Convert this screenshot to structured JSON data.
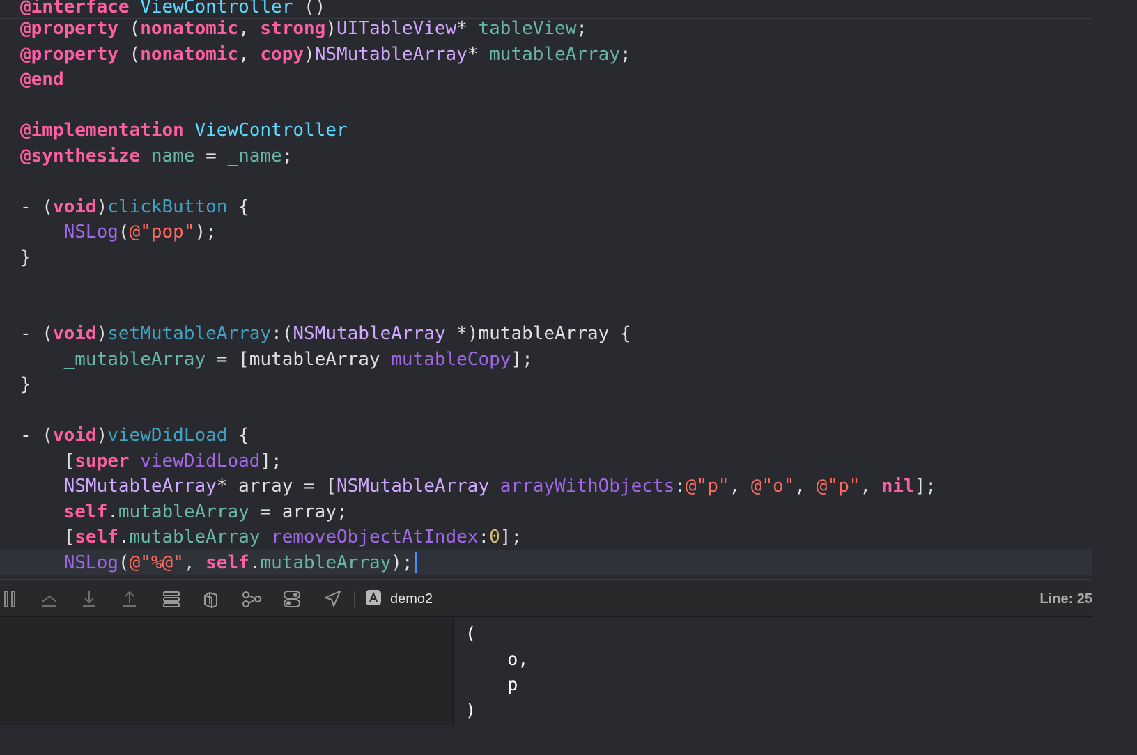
{
  "editor": {
    "lines": [
      {
        "kind": "sticky",
        "tokens": [
          {
            "t": "@interface",
            "c": "kw"
          },
          {
            "t": " ",
            "c": "pl"
          },
          {
            "t": "ViewController",
            "c": "cls"
          },
          {
            "t": " ()",
            "c": "pl"
          }
        ]
      },
      {
        "tokens": [
          {
            "t": "@property",
            "c": "kw"
          },
          {
            "t": " (",
            "c": "pl"
          },
          {
            "t": "nonatomic",
            "c": "kw"
          },
          {
            "t": ", ",
            "c": "pl"
          },
          {
            "t": "strong",
            "c": "kw"
          },
          {
            "t": ")",
            "c": "pl"
          },
          {
            "t": "UITableView",
            "c": "type"
          },
          {
            "t": "* ",
            "c": "pl"
          },
          {
            "t": "tableView",
            "c": "prop"
          },
          {
            "t": ";",
            "c": "pl"
          }
        ]
      },
      {
        "tokens": [
          {
            "t": "@property",
            "c": "kw"
          },
          {
            "t": " (",
            "c": "pl"
          },
          {
            "t": "nonatomic",
            "c": "kw"
          },
          {
            "t": ", ",
            "c": "pl"
          },
          {
            "t": "copy",
            "c": "kw"
          },
          {
            "t": ")",
            "c": "pl"
          },
          {
            "t": "NSMutableArray",
            "c": "type"
          },
          {
            "t": "* ",
            "c": "pl"
          },
          {
            "t": "mutableArray",
            "c": "prop"
          },
          {
            "t": ";",
            "c": "pl"
          }
        ]
      },
      {
        "tokens": [
          {
            "t": "@end",
            "c": "kw"
          }
        ]
      },
      {
        "tokens": []
      },
      {
        "tokens": [
          {
            "t": "@implementation",
            "c": "kw"
          },
          {
            "t": " ",
            "c": "pl"
          },
          {
            "t": "ViewController",
            "c": "cls"
          }
        ]
      },
      {
        "tokens": [
          {
            "t": "@synthesize",
            "c": "kw"
          },
          {
            "t": " ",
            "c": "pl"
          },
          {
            "t": "name",
            "c": "prop"
          },
          {
            "t": " = ",
            "c": "pl"
          },
          {
            "t": "_name",
            "c": "prop"
          },
          {
            "t": ";",
            "c": "pl"
          }
        ]
      },
      {
        "tokens": []
      },
      {
        "tokens": [
          {
            "t": "- (",
            "c": "pl"
          },
          {
            "t": "void",
            "c": "kw"
          },
          {
            "t": ")",
            "c": "pl"
          },
          {
            "t": "clickButton",
            "c": "fn"
          },
          {
            "t": " {",
            "c": "pl"
          }
        ]
      },
      {
        "tokens": [
          {
            "t": "    ",
            "c": "pl"
          },
          {
            "t": "NSLog",
            "c": "func"
          },
          {
            "t": "(",
            "c": "pl"
          },
          {
            "t": "@\"pop\"",
            "c": "str"
          },
          {
            "t": ");",
            "c": "pl"
          }
        ]
      },
      {
        "tokens": [
          {
            "t": "}",
            "c": "pl"
          }
        ]
      },
      {
        "tokens": []
      },
      {
        "tokens": []
      },
      {
        "tokens": [
          {
            "t": "- (",
            "c": "pl"
          },
          {
            "t": "void",
            "c": "kw"
          },
          {
            "t": ")",
            "c": "pl"
          },
          {
            "t": "setMutableArray",
            "c": "fn"
          },
          {
            "t": ":(",
            "c": "pl"
          },
          {
            "t": "NSMutableArray",
            "c": "type"
          },
          {
            "t": " *)mutableArray {",
            "c": "pl"
          }
        ]
      },
      {
        "tokens": [
          {
            "t": "    ",
            "c": "pl"
          },
          {
            "t": "_mutableArray",
            "c": "prop"
          },
          {
            "t": " = [mutableArray ",
            "c": "pl"
          },
          {
            "t": "mutableCopy",
            "c": "func"
          },
          {
            "t": "];",
            "c": "pl"
          }
        ]
      },
      {
        "tokens": [
          {
            "t": "}",
            "c": "pl"
          }
        ]
      },
      {
        "tokens": []
      },
      {
        "tokens": [
          {
            "t": "- (",
            "c": "pl"
          },
          {
            "t": "void",
            "c": "kw"
          },
          {
            "t": ")",
            "c": "pl"
          },
          {
            "t": "viewDidLoad",
            "c": "fn"
          },
          {
            "t": " {",
            "c": "pl"
          }
        ]
      },
      {
        "tokens": [
          {
            "t": "    [",
            "c": "pl"
          },
          {
            "t": "super",
            "c": "kw"
          },
          {
            "t": " ",
            "c": "pl"
          },
          {
            "t": "viewDidLoad",
            "c": "func"
          },
          {
            "t": "];",
            "c": "pl"
          }
        ]
      },
      {
        "tokens": [
          {
            "t": "    ",
            "c": "pl"
          },
          {
            "t": "NSMutableArray",
            "c": "type"
          },
          {
            "t": "* array = [",
            "c": "pl"
          },
          {
            "t": "NSMutableArray",
            "c": "type"
          },
          {
            "t": " ",
            "c": "pl"
          },
          {
            "t": "arrayWithObjects",
            "c": "func"
          },
          {
            "t": ":",
            "c": "pl"
          },
          {
            "t": "@\"p\"",
            "c": "str"
          },
          {
            "t": ", ",
            "c": "pl"
          },
          {
            "t": "@\"o\"",
            "c": "str"
          },
          {
            "t": ", ",
            "c": "pl"
          },
          {
            "t": "@\"p\"",
            "c": "str"
          },
          {
            "t": ", ",
            "c": "pl"
          },
          {
            "t": "nil",
            "c": "kw"
          },
          {
            "t": "];",
            "c": "pl"
          }
        ]
      },
      {
        "tokens": [
          {
            "t": "    ",
            "c": "pl"
          },
          {
            "t": "self",
            "c": "kw"
          },
          {
            "t": ".",
            "c": "pl"
          },
          {
            "t": "mutableArray",
            "c": "prop"
          },
          {
            "t": " = array;",
            "c": "pl"
          }
        ]
      },
      {
        "tokens": [
          {
            "t": "    [",
            "c": "pl"
          },
          {
            "t": "self",
            "c": "kw"
          },
          {
            "t": ".",
            "c": "pl"
          },
          {
            "t": "mutableArray",
            "c": "prop"
          },
          {
            "t": " ",
            "c": "pl"
          },
          {
            "t": "removeObjectAtIndex",
            "c": "func"
          },
          {
            "t": ":",
            "c": "pl"
          },
          {
            "t": "0",
            "c": "num"
          },
          {
            "t": "];",
            "c": "pl"
          }
        ]
      },
      {
        "kind": "current",
        "tokens": [
          {
            "t": "    ",
            "c": "pl"
          },
          {
            "t": "NSLog",
            "c": "func"
          },
          {
            "t": "(",
            "c": "pl"
          },
          {
            "t": "@\"%@\"",
            "c": "str"
          },
          {
            "t": ", ",
            "c": "pl"
          },
          {
            "t": "self",
            "c": "kw"
          },
          {
            "t": ".",
            "c": "pl"
          },
          {
            "t": "mutableArray",
            "c": "prop"
          },
          {
            "t": ");",
            "c": "pl"
          }
        ]
      }
    ]
  },
  "debug_bar": {
    "icons": [
      {
        "name": "hide-debug-area-icon",
        "interactable": true
      },
      {
        "name": "step-over-icon",
        "interactable": true
      },
      {
        "name": "step-into-icon",
        "interactable": true
      },
      {
        "name": "step-out-icon",
        "interactable": true
      },
      {
        "name": "debug-view-hierarchy-icon",
        "interactable": true
      },
      {
        "name": "debug-memory-graph-icon",
        "interactable": true
      },
      {
        "name": "environment-overrides-icon",
        "interactable": true
      },
      {
        "name": "simulate-location-icon",
        "interactable": true
      }
    ],
    "scheme_label": "demo2",
    "line_indicator": "Line: 25"
  },
  "console": {
    "lines": [
      "(",
      "    o,",
      "    p",
      ")"
    ]
  }
}
